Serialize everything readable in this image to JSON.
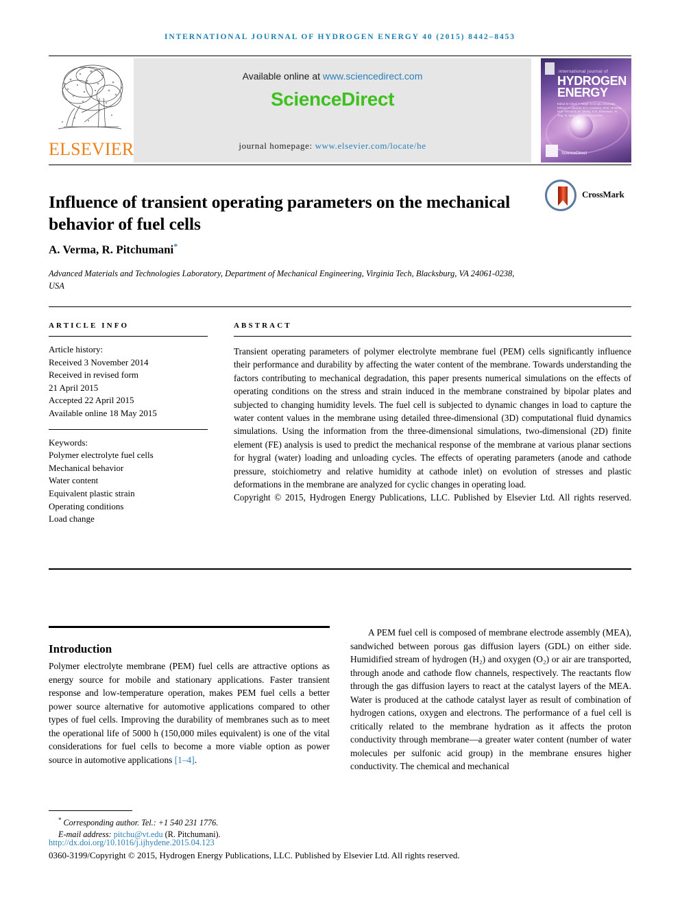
{
  "running_head": "International Journal of Hydrogen Energy 40 (2015) 8442–8453",
  "masthead": {
    "publisher_name": "ELSEVIER",
    "publisher_logo_alt": "elsevier-tree-logo",
    "available_prefix": "Available online at ",
    "available_link": "www.sciencedirect.com",
    "brand": "ScienceDirect",
    "homepage_prefix": "journal homepage: ",
    "homepage_link": "www.elsevier.com/locate/he",
    "cover": {
      "kicker": "international journal of",
      "title_line1": "HYDROGEN",
      "title_line2": "ENERGY",
      "editors": "Editor-in-Chief: T. Nejat Veziroglu   Associate Editors: A. Bielicki, E.C. Cardona, W.M. Almeida, M.D. Hemphill, M. Shetty, S.R. Srinivasan, M. Ting, R. Wang, P. Sakellaropoulos",
      "sciencedirect_label": "ScienceDirect"
    }
  },
  "article": {
    "title": "Influence of transient operating parameters on the mechanical behavior of fuel cells",
    "crossmark_label": "CrossMark",
    "authors": "A. Verma, R. Pitchumani",
    "corresponding_marker": "*",
    "affiliation": "Advanced Materials and Technologies Laboratory, Department of Mechanical Engineering, Virginia Tech, Blacksburg, VA 24061-0238, USA"
  },
  "article_info": {
    "label": "Article info",
    "history_label": "Article history:",
    "history": [
      "Received 3 November 2014",
      "Received in revised form",
      "21 April 2015",
      "Accepted 22 April 2015",
      "Available online 18 May 2015"
    ],
    "keywords_label": "Keywords:",
    "keywords": [
      "Polymer electrolyte fuel cells",
      "Mechanical behavior",
      "Water content",
      "Equivalent plastic strain",
      "Operating conditions",
      "Load change"
    ]
  },
  "abstract": {
    "label": "Abstract",
    "text": "Transient operating parameters of polymer electrolyte membrane fuel (PEM) cells significantly influence their performance and durability by affecting the water content of the membrane. Towards understanding the factors contributing to mechanical degradation, this paper presents numerical simulations on the effects of operating conditions on the stress and strain induced in the membrane constrained by bipolar plates and subjected to changing humidity levels. The fuel cell is subjected to dynamic changes in load to capture the water content values in the membrane using detailed three-dimensional (3D) computational fluid dynamics simulations. Using the information from the three-dimensional simulations, two-dimensional (2D) finite element (FE) analysis is used to predict the mechanical response of the membrane at various planar sections for hygral (water) loading and unloading cycles. The effects of operating parameters (anode and cathode pressure, stoichiometry and relative humidity at cathode inlet) on evolution of stresses and plastic deformations in the membrane are analyzed for cyclic changes in operating load.",
    "copyright": "Copyright © 2015, Hydrogen Energy Publications, LLC. Published by Elsevier Ltd. All rights reserved."
  },
  "body": {
    "section_heading": "Introduction",
    "left_paragraph_part1": "Polymer electrolyte membrane (PEM) fuel cells are attractive options as energy source for mobile and stationary applications. Faster transient response and low-temperature operation, makes PEM fuel cells a better power source alternative for automotive applications compared to other types of fuel cells. Improving the durability of membranes such as to meet the operational life of 5000 h (150,000 miles equivalent) is one of the vital considerations for fuel cells to become a more viable option as power source in automotive applications ",
    "left_paragraph_citation": "[1–4]",
    "left_paragraph_part2": ".",
    "right_paragraph": "A PEM fuel cell is composed of membrane electrode assembly (MEA), sandwiched between porous gas diffusion layers (GDL) on either side. Humidified stream of hydrogen (H₂) and oxygen (O₂) or air are transported, through anode and cathode flow channels, respectively. The reactants flow through the gas diffusion layers to react at the catalyst layers of the MEA. Water is produced at the cathode catalyst layer as result of combination of hydrogen cations, oxygen and electrons. The performance of a fuel cell is critically related to the membrane hydration as it affects the proton conductivity through membrane—a greater water content (number of water molecules per sulfonic acid group) in the membrane ensures higher conductivity. The chemical and mechanical"
  },
  "footer": {
    "corresponding_star": "*",
    "corresponding_text": "Corresponding author. Tel.: +1 540 231 1776.",
    "email_label": "E-mail address: ",
    "email": "pitchu@vt.edu",
    "email_suffix": " (R. Pitchumani).",
    "doi": "http://dx.doi.org/10.1016/j.ijhydene.2015.04.123",
    "issn_line": "0360-3199/Copyright © 2015, Hydrogen Energy Publications, LLC. Published by Elsevier Ltd. All rights reserved."
  },
  "colors": {
    "link": "#2a7fb8",
    "elsevier_orange": "#ef8019",
    "sciencedirect_green": "#3ec01f",
    "running_head": "#1a7fb5"
  }
}
